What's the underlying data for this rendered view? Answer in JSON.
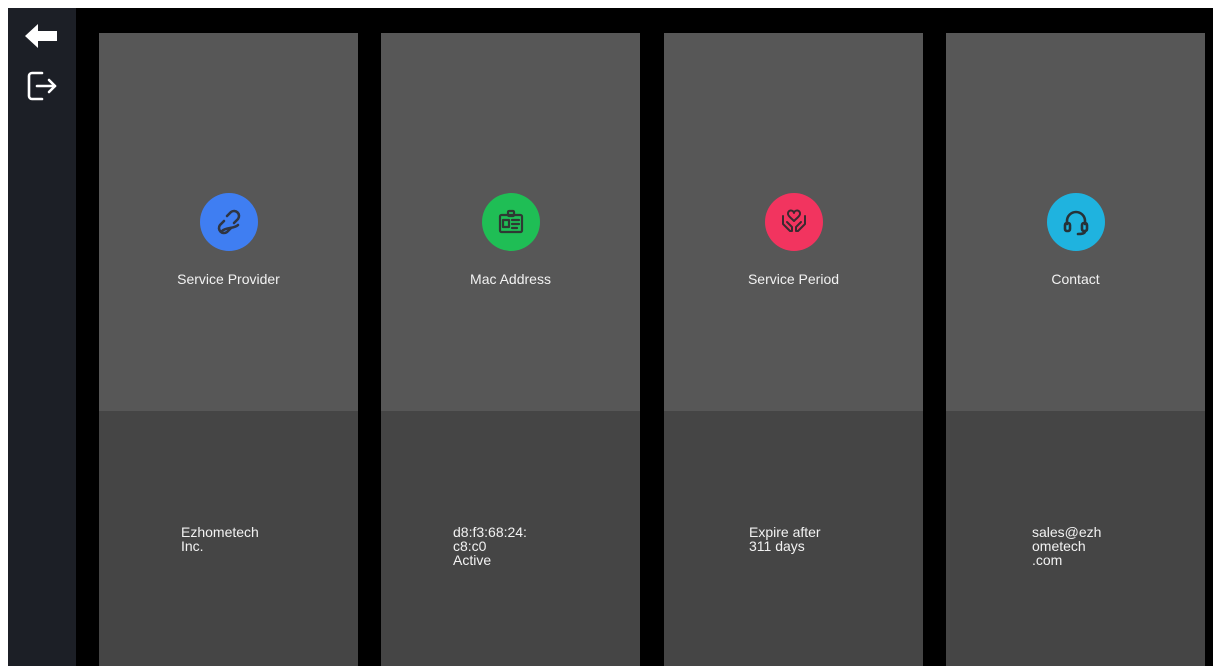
{
  "sidebar": {
    "back_icon": "arrow-left-icon",
    "logout_icon": "logout-icon"
  },
  "cards": [
    {
      "title": "Service Provider",
      "icon": "link-icon",
      "color": "#3f7ef2",
      "value_lines": [
        "Ezhometech",
        "Inc."
      ]
    },
    {
      "title": "Mac Address",
      "icon": "id-card-icon",
      "color": "#1fbe55",
      "value_lines": [
        "d8:f3:68:24:",
        "c8:c0",
        "Active"
      ]
    },
    {
      "title": "Service Period",
      "icon": "hands-heart-icon",
      "color": "#f2345f",
      "value_lines": [
        "Expire after",
        "311 days"
      ]
    },
    {
      "title": "Contact",
      "icon": "headset-icon",
      "color": "#1fb3df",
      "value_lines": [
        "sales@ezh",
        "ometech",
        ".com"
      ]
    }
  ]
}
